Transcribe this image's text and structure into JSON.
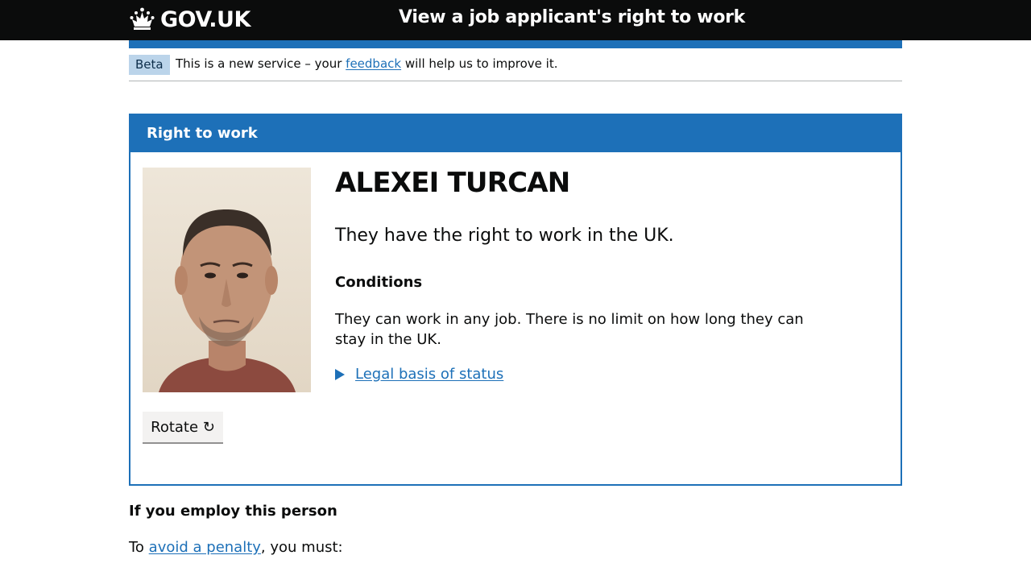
{
  "header": {
    "logo_text": "GOV.UK",
    "service_name": "View a job applicant's right to work"
  },
  "phase_banner": {
    "tag": "Beta",
    "text_before": "This is a new service – your ",
    "link_text": "feedback",
    "text_after": " will help us to improve it."
  },
  "card": {
    "header": "Right to work",
    "name": "ALEXEI TURCAN",
    "status": "They have the right to work in the UK.",
    "conditions_heading": "Conditions",
    "conditions_text": "They can work in any job. There is no limit on how long they can stay in the UK.",
    "details_summary": "Legal basis of status",
    "rotate_button": "Rotate ↻"
  },
  "employ": {
    "heading": "If you employ this person",
    "before_link": "To ",
    "link_text": "avoid a penalty",
    "after_link": ", you must:"
  },
  "colors": {
    "header_bg": "#0b0c0c",
    "brand_blue": "#1d70b8",
    "phase_tag_bg": "#bbd4ea",
    "link": "#1d70b8"
  }
}
